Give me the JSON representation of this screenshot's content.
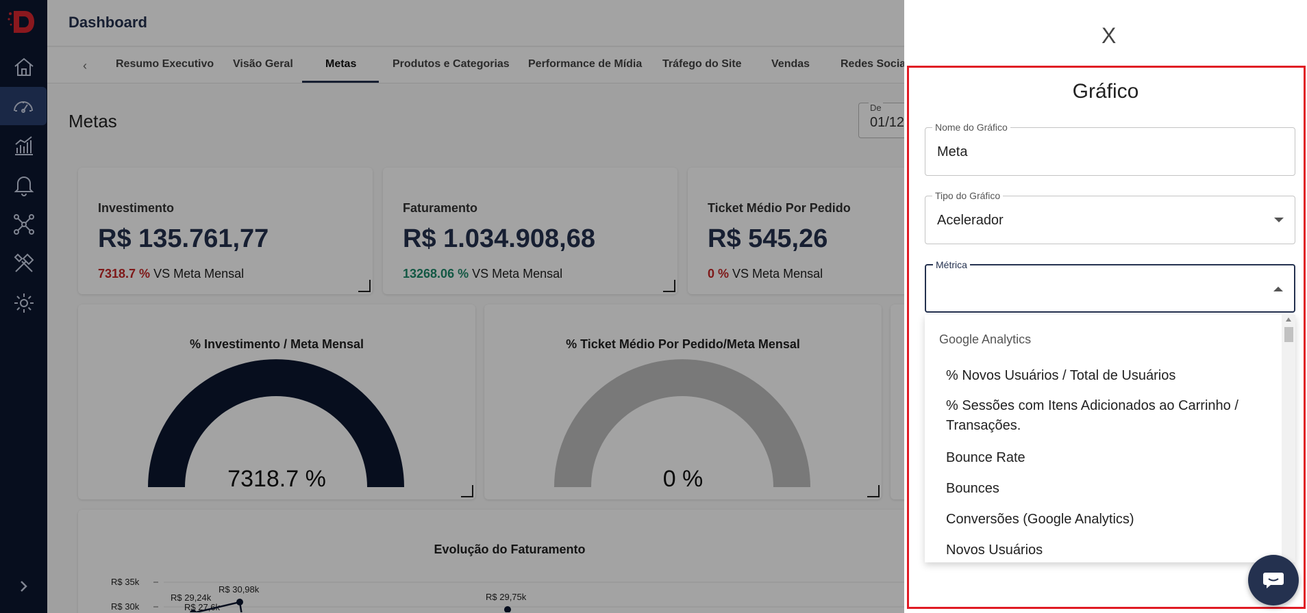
{
  "sidebar": {
    "items": [
      {
        "icon": "home-icon"
      },
      {
        "icon": "dashboard-gauge-icon",
        "active": true
      },
      {
        "icon": "chart-icon"
      },
      {
        "icon": "bell-icon"
      },
      {
        "icon": "network-icon"
      },
      {
        "icon": "tools-icon"
      },
      {
        "icon": "gear-icon"
      }
    ]
  },
  "header": {
    "title": "Dashboard"
  },
  "tabs": [
    "Resumo Executivo",
    "Visão Geral",
    "Metas",
    "Produtos e Categorias",
    "Performance de Mídia",
    "Tráfego do Site",
    "Vendas",
    "Redes Sociais"
  ],
  "page": {
    "title": "Metas",
    "date_label": "De",
    "date_value": "01/12"
  },
  "kpis": [
    {
      "name": "Investimento",
      "value": "R$ 135.761,77",
      "pct": "7318.7 %",
      "pct_color": "#c62828",
      "suffix": "VS Meta Mensal"
    },
    {
      "name": "Faturamento",
      "value": "R$ 1.034.908,68",
      "pct": "13268.06 %",
      "pct_color": "#1f8a6b",
      "suffix": "VS Meta Mensal"
    },
    {
      "name": "Ticket Médio Por Pedido",
      "value": "R$ 545,26",
      "pct": "0 %",
      "pct_color": "#c62828",
      "suffix": "VS Meta Mensal"
    }
  ],
  "gauges": [
    {
      "title": "% Investimento / Meta Mensal",
      "value": "7318.7 %",
      "color": "#0b1730",
      "fraction": 1
    },
    {
      "title": "% Ticket Médio Por Pedido/Meta Mensal",
      "value": "0 %",
      "color": "#bdbdbd",
      "fraction": 0
    }
  ],
  "evolution": {
    "title": "Evolução do Faturamento",
    "y_ticks": [
      "R$ 35k",
      "R$ 30k"
    ],
    "labels": [
      "R$ 29,24k",
      "R$ 27,6k",
      "R$ 30,98k",
      "R$ 29,75k"
    ]
  },
  "panel": {
    "close": "X",
    "title": "Gráfico",
    "chart_name_label": "Nome do Gráfico",
    "chart_name_value": "Meta",
    "chart_type_label": "Tipo do Gráfico",
    "chart_type_value": "Acelerador",
    "metric_label": "Métrica",
    "dropdown": {
      "group": "Google Analytics",
      "options": [
        "% Novos Usuários / Total de Usuários",
        "% Sessões com Itens Adicionados ao Carrinho / Transações.",
        "Bounce Rate",
        "Bounces",
        "Conversões (Google Analytics)",
        "Novos Usuários"
      ]
    }
  },
  "colors": {
    "accent": "#24314f",
    "sidebar": "#0b1730",
    "highlight_frame": "#e01b24"
  }
}
